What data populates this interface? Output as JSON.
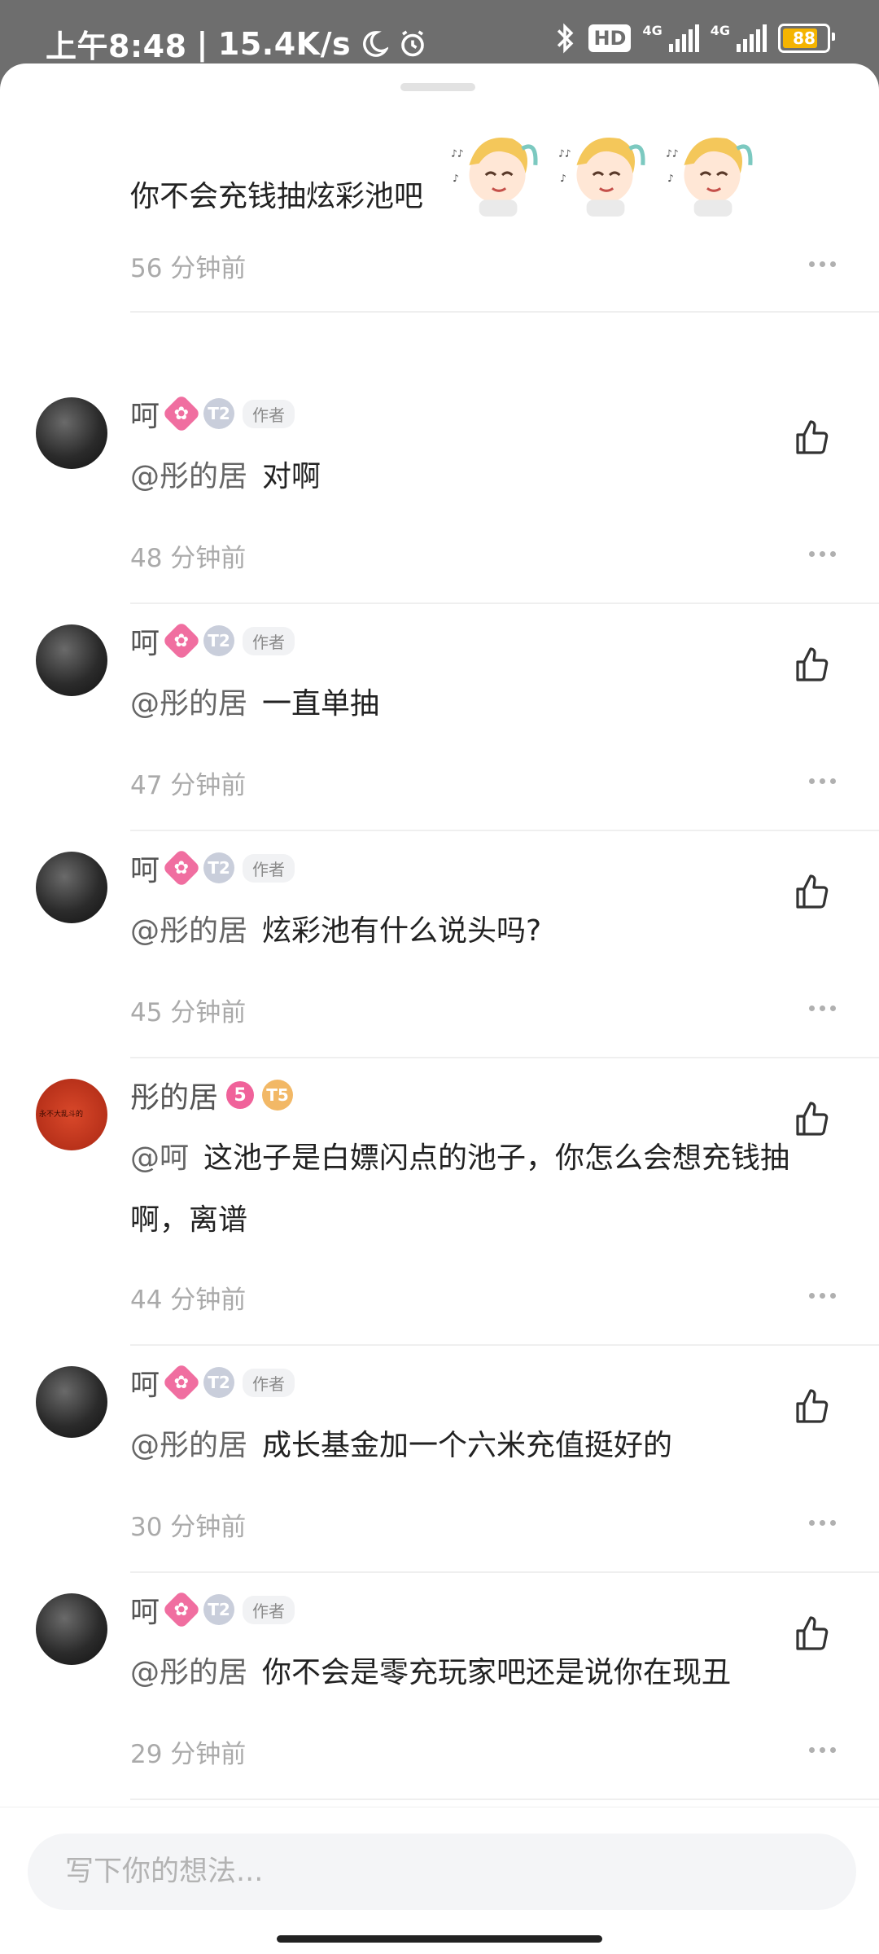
{
  "status_bar": {
    "time": "上午8:48",
    "speed": "15.4K/s",
    "hd": "HD",
    "net1": "4G",
    "net2": "4G",
    "battery": "88"
  },
  "top_comment": {
    "text": "你不会充钱抽炫彩池吧",
    "time": "56 分钟前"
  },
  "comments": [
    {
      "name": "呵",
      "level": "",
      "t_level": "T2",
      "author": "作者",
      "mention": "@彤的居",
      "text": "对啊",
      "time": "48 分钟前"
    },
    {
      "name": "呵",
      "level": "",
      "t_level": "T2",
      "author": "作者",
      "mention": "@彤的居",
      "text": "一直单抽",
      "time": "47 分钟前"
    },
    {
      "name": "呵",
      "level": "",
      "t_level": "T2",
      "author": "作者",
      "mention": "@彤的居",
      "text": "炫彩池有什么说头吗?",
      "time": "45 分钟前"
    },
    {
      "name": "彤的居",
      "level": "5",
      "t_level": "T5",
      "author": "",
      "mention": "@呵",
      "text": "这池子是白嫖闪点的池子，你怎么会想充钱抽啊，离谱",
      "time": "44 分钟前"
    },
    {
      "name": "呵",
      "level": "",
      "t_level": "T2",
      "author": "作者",
      "mention": "@彤的居",
      "text": "成长基金加一个六米充值挺好的",
      "time": "30 分钟前"
    },
    {
      "name": "呵",
      "level": "",
      "t_level": "T2",
      "author": "作者",
      "mention": "@彤的居",
      "text": "你不会是零充玩家吧还是说你在现丑",
      "time": "29 分钟前"
    }
  ],
  "input": {
    "placeholder": "写下你的想法..."
  }
}
